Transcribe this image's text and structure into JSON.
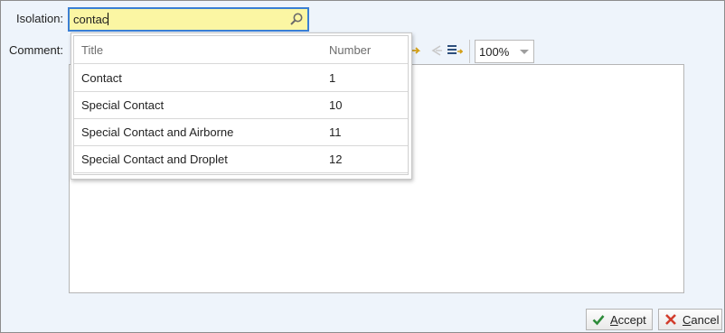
{
  "form": {
    "isolation_label": "Isolation:",
    "comment_label": "Comment:"
  },
  "search": {
    "value": "contac"
  },
  "dropdown": {
    "columns": [
      "Title",
      "Number"
    ],
    "rows": [
      {
        "title": "Contact",
        "number": "1"
      },
      {
        "title": "Special Contact",
        "number": "10"
      },
      {
        "title": "Special Contact and Airborne",
        "number": "11"
      },
      {
        "title": "Special Contact and Droplet",
        "number": "12"
      }
    ]
  },
  "toolbar": {
    "zoom_value": "100%",
    "icons": [
      "redo-arrow-icon",
      "unindent-icon",
      "list-indent-icon"
    ]
  },
  "buttons": {
    "accept_mnemonic": "A",
    "accept_rest": "ccept",
    "cancel_mnemonic": "C",
    "cancel_rest": "ancel"
  },
  "colors": {
    "search_bg": "#fbf6a3",
    "focus_border": "#3a7fd4",
    "accept_green": "#2e8b3a",
    "cancel_red": "#d23c2c"
  }
}
